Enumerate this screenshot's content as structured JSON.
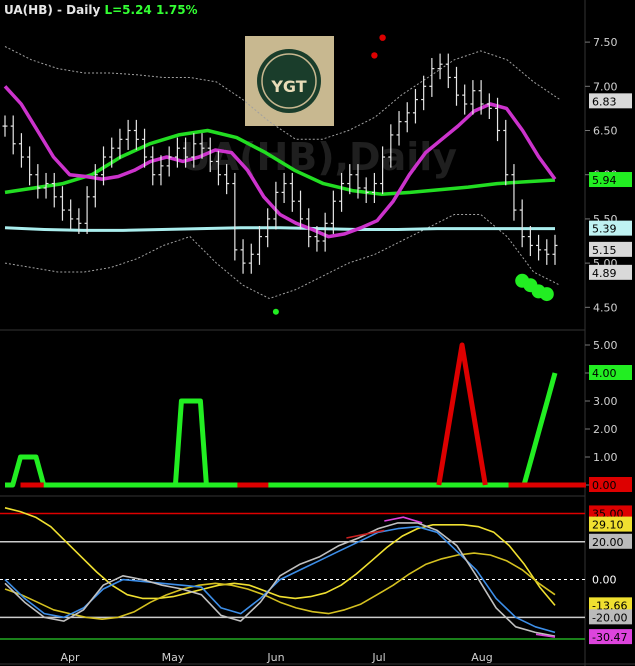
{
  "chart_data": [
    {
      "type": "ohlc",
      "title": "UA(HB) - Daily",
      "last_label": "L=5.24",
      "change_label": "1.75%",
      "watermark": "UA(HB),Daily",
      "logo_text": "YGT",
      "colors": {
        "price": "#e6e6e6",
        "sma_fast": "#cc33cc",
        "sma_mid": "#22dd22",
        "sma_slow": "#aaeeee",
        "bands": "#a0a0a0",
        "dots_red": "#dd0000",
        "dots_green": "#22ee22"
      },
      "y_ticks": [
        "7.50",
        "7.00",
        "6.50",
        "6.00",
        "5.50",
        "5.00",
        "4.50"
      ],
      "ylim": [
        4.3,
        7.75
      ],
      "x_ticks": [
        "Apr",
        "May",
        "Jun",
        "Jul",
        "Aug"
      ],
      "value_tags": [
        {
          "label": "6.83",
          "bg": "#d9d9d9",
          "fg": "#000"
        },
        {
          "label": "5.94",
          "bg": "#22ee22",
          "fg": "#000"
        },
        {
          "label": "5.39",
          "bg": "#bff2f2",
          "fg": "#000"
        },
        {
          "label": "5.15",
          "bg": "#d9d9d9",
          "fg": "#000"
        },
        {
          "label": "4.89",
          "bg": "#d9d9d9",
          "fg": "#000"
        }
      ],
      "price_path": [
        6.55,
        6.35,
        6.2,
        6.0,
        5.85,
        5.9,
        5.75,
        5.6,
        5.5,
        5.45,
        5.75,
        6.0,
        6.2,
        6.3,
        6.4,
        6.5,
        6.4,
        6.2,
        6.0,
        6.1,
        6.2,
        6.3,
        6.2,
        6.35,
        6.3,
        6.15,
        6.0,
        5.9,
        5.15,
        5.0,
        5.1,
        5.3,
        5.5,
        5.8,
        5.9,
        5.7,
        5.5,
        5.3,
        5.25,
        5.45,
        5.7,
        5.9,
        6.0,
        5.85,
        5.8,
        5.9,
        6.2,
        6.45,
        6.6,
        6.7,
        6.85,
        7.0,
        7.2,
        7.25,
        7.1,
        6.9,
        6.8,
        6.95,
        6.8,
        6.75,
        6.5,
        6.0,
        5.6,
        5.3,
        5.2,
        5.15,
        5.1,
        5.2
      ],
      "sma_fast_path": [
        7.0,
        6.8,
        6.5,
        6.2,
        6.0,
        5.98,
        5.95,
        5.98,
        6.05,
        6.15,
        6.2,
        6.15,
        6.2,
        6.28,
        6.25,
        6.05,
        5.75,
        5.55,
        5.45,
        5.38,
        5.3,
        5.33,
        5.4,
        5.48,
        5.7,
        6.0,
        6.25,
        6.4,
        6.55,
        6.72,
        6.8,
        6.75,
        6.5,
        6.2,
        5.95
      ],
      "sma_mid_path": [
        5.8,
        5.85,
        5.9,
        6.0,
        6.2,
        6.35,
        6.45,
        6.5,
        6.42,
        6.25,
        6.05,
        5.9,
        5.82,
        5.78,
        5.8,
        5.83,
        5.86,
        5.9,
        5.92,
        5.94
      ],
      "sma_slow_path": [
        5.4,
        5.38,
        5.37,
        5.37,
        5.38,
        5.39,
        5.4,
        5.4,
        5.39,
        5.38,
        5.38,
        5.39,
        5.39,
        5.39,
        5.39
      ],
      "band_upper_path": [
        7.45,
        7.3,
        7.2,
        7.15,
        7.15,
        7.13,
        7.1,
        7.1,
        7.05,
        6.85,
        6.6,
        6.4,
        6.4,
        6.5,
        6.65,
        6.9,
        7.1,
        7.3,
        7.4,
        7.3,
        7.05,
        6.85
      ],
      "band_lower_path": [
        5.0,
        4.95,
        4.9,
        4.9,
        4.95,
        5.05,
        5.2,
        5.3,
        5.0,
        4.75,
        4.6,
        4.7,
        4.85,
        5.0,
        5.1,
        5.25,
        5.4,
        5.55,
        5.55,
        5.3,
        4.9,
        4.75
      ],
      "red_dots": [
        [
          45,
          7.35
        ],
        [
          46,
          7.55
        ]
      ],
      "green_dots": [
        [
          33,
          4.45
        ],
        [
          63,
          4.8
        ],
        [
          64,
          4.75
        ],
        [
          65,
          4.68
        ],
        [
          66,
          4.65
        ]
      ]
    },
    {
      "type": "step",
      "y_ticks": [
        "5.00",
        "4.00",
        "3.00",
        "2.00",
        "1.00",
        "0.00"
      ],
      "ylim": [
        0,
        5
      ],
      "value_tags": [
        {
          "label": "4.00",
          "bg": "#22ee22",
          "fg": "#000"
        },
        {
          "label": "0.00",
          "bg": "#dd0000",
          "fg": "#000"
        }
      ],
      "green_path": [
        0,
        0,
        1,
        1,
        1,
        0,
        0,
        0,
        0,
        0,
        0,
        0,
        0,
        0,
        0,
        0,
        0,
        0,
        0,
        0,
        0,
        0,
        0,
        0,
        0,
        0,
        0,
        0,
        0,
        0,
        0,
        0,
        0,
        0,
        0,
        0,
        0,
        0,
        0,
        0,
        0,
        0,
        0,
        0,
        0,
        0,
        0,
        0,
        0,
        0,
        0,
        0,
        0,
        0,
        0,
        0,
        0,
        0,
        0,
        0,
        0,
        0,
        0,
        0,
        0,
        0,
        0,
        0,
        1,
        2,
        3,
        4
      ],
      "green_peaks": [
        {
          "start": 22,
          "end": 26,
          "value": 3
        }
      ],
      "red_peaks": [
        {
          "start": 56,
          "end": 62,
          "value": 5
        }
      ],
      "red_segments": [
        [
          2,
          5
        ],
        [
          30,
          34
        ],
        [
          65,
          75
        ]
      ]
    },
    {
      "type": "line",
      "y_ticks": [
        "35.00",
        "29.10",
        "20.00",
        "0.00",
        "-13.66",
        "-20.00",
        "-30.47"
      ],
      "ylim": [
        -32,
        40
      ],
      "hlines": [
        {
          "value": 35,
          "color": "#dd0000"
        },
        {
          "value": 20,
          "color": "#cccccc"
        },
        {
          "value": 0,
          "color": "#ffffff",
          "dashed": true
        },
        {
          "value": -20,
          "color": "#cccccc"
        }
      ],
      "value_tags": [
        {
          "label": "35.00",
          "bg": "#dd0000",
          "fg": "#000"
        },
        {
          "label": "29.10",
          "bg": "#f0e030",
          "fg": "#000"
        },
        {
          "label": "20.00",
          "bg": "#bbbbbb",
          "fg": "#000"
        },
        {
          "label": "0.00",
          "bg": "#000000",
          "fg": "#ffffff"
        },
        {
          "label": "-13.66",
          "bg": "#f0e030",
          "fg": "#000"
        },
        {
          "label": "-20.00",
          "bg": "#bbbbbb",
          "fg": "#000"
        },
        {
          "label": "-30.47",
          "bg": "#dd44dd",
          "fg": "#000"
        }
      ],
      "series": [
        {
          "color": "#f0e030",
          "values": [
            38,
            36,
            33,
            28,
            20,
            12,
            4,
            -3,
            -8,
            -10,
            -10,
            -9,
            -7,
            -5,
            -3,
            -2,
            -3,
            -6,
            -9,
            -10,
            -9,
            -7,
            -3,
            3,
            10,
            17,
            23,
            27,
            29,
            29,
            29,
            28,
            25,
            18,
            8,
            -4,
            -13.66
          ]
        },
        {
          "color": "#d4c020",
          "values": [
            -5,
            -8,
            -12,
            -16,
            -18,
            -20,
            -21,
            -20,
            -17,
            -12,
            -8,
            -5,
            -3,
            -2,
            -3,
            -5,
            -8,
            -12,
            -15,
            -17,
            -18,
            -16,
            -13,
            -8,
            -3,
            3,
            8,
            11,
            13,
            14,
            13,
            10,
            5,
            -2,
            -8
          ]
        },
        {
          "color": "#3d8ee8",
          "values": [
            0,
            -10,
            -18,
            -20,
            -15,
            -5,
            0,
            -1,
            -2,
            -3,
            -4,
            -15,
            -18,
            -10,
            0,
            5,
            10,
            15,
            20,
            25,
            27,
            28,
            25,
            15,
            5,
            -10,
            -20,
            -25,
            -28
          ]
        },
        {
          "color": "#c0c0c0",
          "values": [
            -2,
            -12,
            -20,
            -22,
            -16,
            -3,
            2,
            0,
            -3,
            -5,
            -8,
            -19,
            -22,
            -12,
            2,
            8,
            12,
            18,
            22,
            27,
            30,
            30,
            26,
            18,
            2,
            -15,
            -25,
            -28,
            -30
          ]
        },
        {
          "color": "#dd44dd",
          "values": [
            null,
            null,
            null,
            null,
            null,
            null,
            null,
            null,
            null,
            null,
            null,
            null,
            null,
            null,
            null,
            null,
            null,
            null,
            null,
            null,
            31,
            33,
            30,
            null,
            null,
            null,
            null,
            null,
            -29,
            -30.47
          ]
        },
        {
          "color": "#cc2222",
          "values": [
            null,
            null,
            null,
            null,
            null,
            null,
            null,
            null,
            null,
            null,
            null,
            null,
            null,
            null,
            null,
            null,
            null,
            null,
            22,
            24,
            26,
            null,
            null,
            null,
            null,
            null,
            null,
            null,
            null,
            null
          ]
        }
      ]
    }
  ]
}
